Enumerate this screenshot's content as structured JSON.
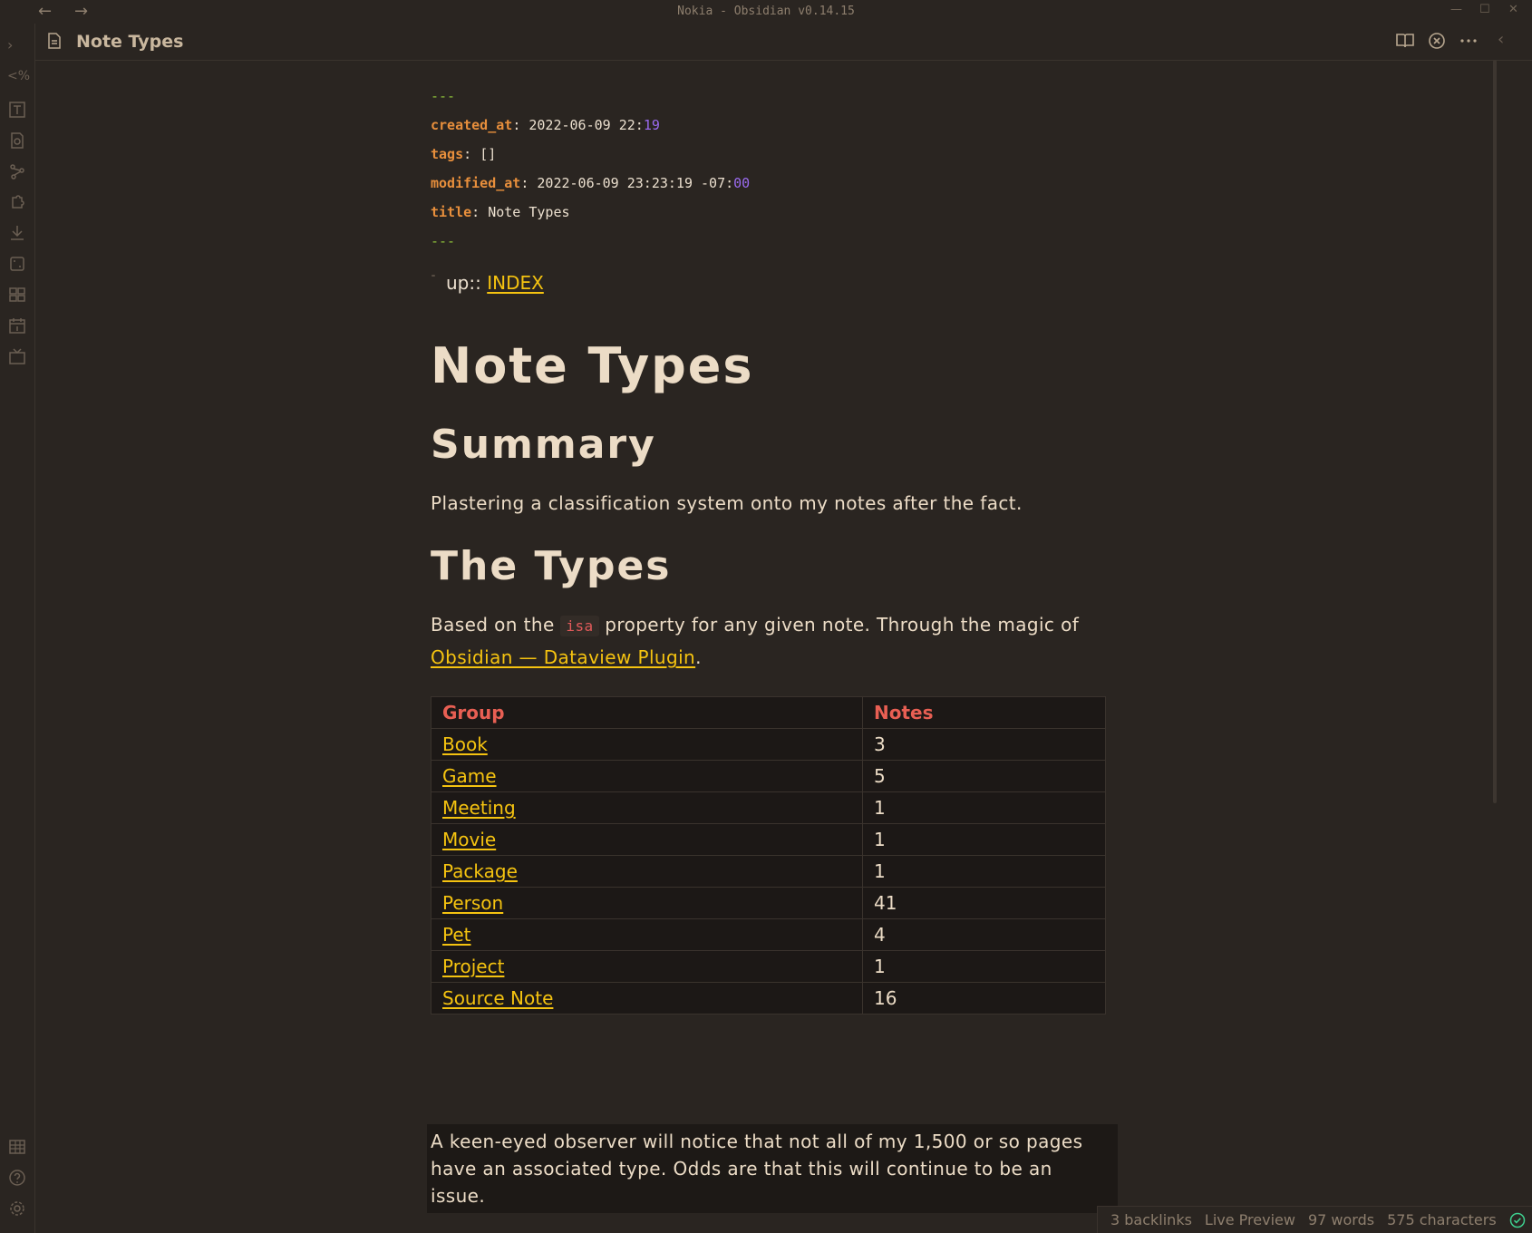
{
  "window": {
    "title": "Nokia - Obsidian v0.14.15"
  },
  "tab": {
    "title": "Note Types"
  },
  "frontmatter": {
    "delimiter": "---",
    "created_at": {
      "key": "created_at",
      "value": "2022-06-09 22:",
      "tail": "19"
    },
    "tags": {
      "key": "tags",
      "value": "[]"
    },
    "modified_at": {
      "key": "modified_at",
      "value": "2022-06-09 23:23:19 -07:",
      "tail": "00"
    },
    "title": {
      "key": "title",
      "value": "Note Types"
    }
  },
  "up": {
    "label": "up::",
    "link": "INDEX"
  },
  "heading": "Note Types",
  "summary": {
    "heading": "Summary",
    "text": "Plastering a classification system onto my notes after the fact."
  },
  "types": {
    "heading": "The Types",
    "intro_before": "Based on the",
    "code": "isa",
    "intro_after": "property for any given note. Through the magic of",
    "link": "Obsidian — Dataview Plugin",
    "link_after": ".",
    "table": {
      "headers": [
        "Group",
        "Notes"
      ],
      "rows": [
        {
          "group": "Book",
          "notes": "3"
        },
        {
          "group": "Game",
          "notes": "5"
        },
        {
          "group": "Meeting",
          "notes": "1"
        },
        {
          "group": "Movie",
          "notes": "1"
        },
        {
          "group": "Package",
          "notes": "1"
        },
        {
          "group": "Person",
          "notes": "41"
        },
        {
          "group": "Pet",
          "notes": "4"
        },
        {
          "group": "Project",
          "notes": "1"
        },
        {
          "group": "Source Note",
          "notes": "16"
        }
      ]
    }
  },
  "footnote": "A keen-eyed observer will notice that not all of my 1,500 or so pages have an associated type. Odds are that this will continue to be an issue.",
  "status": {
    "backlinks": "3 backlinks",
    "mode": "Live Preview",
    "words": "97 words",
    "characters": "575 characters"
  }
}
